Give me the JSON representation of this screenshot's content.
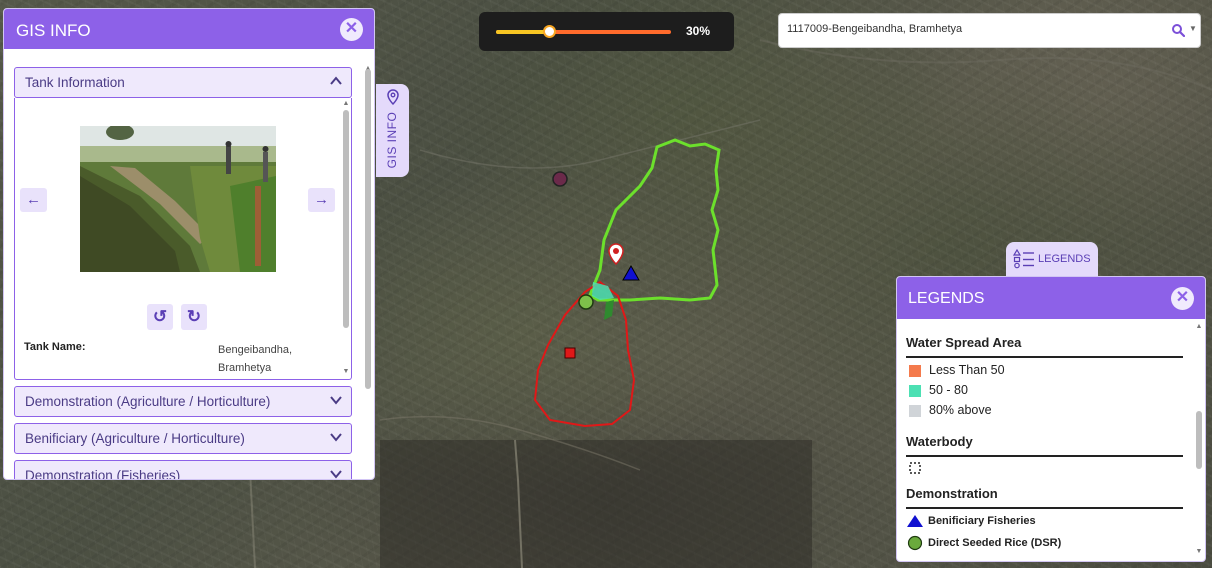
{
  "opacity": {
    "value": 0.3,
    "label": "30%"
  },
  "search": {
    "value": "1117009-Bengeibandha, Bramhetya",
    "placeholder": ""
  },
  "gis_panel": {
    "title": "GIS INFO",
    "sections": [
      {
        "label": "Tank Information",
        "expanded": true
      },
      {
        "label": "Demonstration (Agriculture / Horticulture)",
        "expanded": false
      },
      {
        "label": "Benificiary (Agriculture / Horticulture)",
        "expanded": false
      },
      {
        "label": "Demonstration (Fisheries)",
        "expanded": false
      }
    ],
    "tank": {
      "name_label": "Tank Name:",
      "name_value": "Bengeibandha, Bramhetya"
    }
  },
  "gis_tab": {
    "label": "GIS INFO"
  },
  "legend_tab": {
    "label": "LEGENDS"
  },
  "legends": {
    "title": "LEGENDS",
    "water_spread": {
      "title": "Water Spread Area",
      "items": [
        {
          "label": "Less Than 50",
          "color": "#f47a4c"
        },
        {
          "label": "50 - 80",
          "color": "#4ce0b3"
        },
        {
          "label": "80% above",
          "color": "#d0d4d8"
        }
      ]
    },
    "waterbody": {
      "title": "Waterbody"
    },
    "demonstration": {
      "title": "Demonstration",
      "items": [
        {
          "label": "Benificiary Fisheries",
          "symbol": "triangle",
          "color": "#1010d0"
        },
        {
          "label": "Direct Seeded Rice (DSR)",
          "symbol": "circle",
          "color": "#6aaa3c"
        }
      ]
    }
  },
  "colors": {
    "accent": "#8d61e8",
    "accent_light": "#efe9fc",
    "tank_boundary": "#6ce02c",
    "catchment_boundary": "#e01818"
  }
}
